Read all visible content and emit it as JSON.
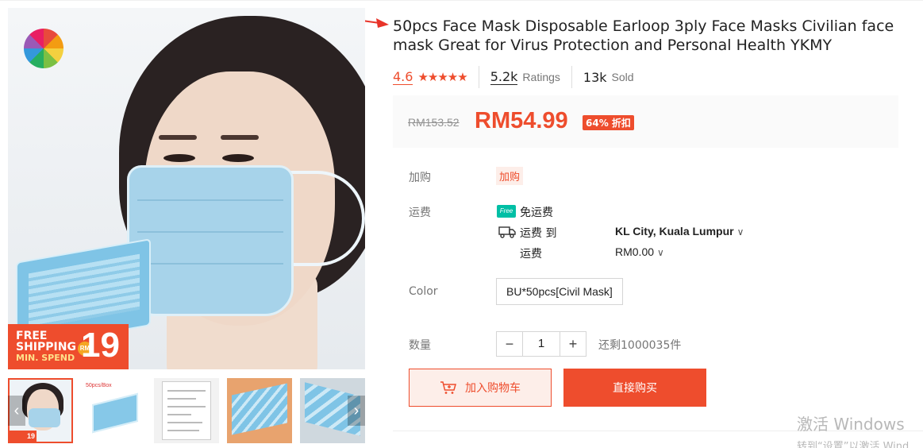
{
  "product": {
    "title": "50pcs Face Mask Disposable Earloop 3ply Face Masks Civilian face mask Great for Virus Protection and Personal Health YKMY"
  },
  "main_image": {
    "promo": {
      "line1": "FREE",
      "line2": "SHIPPING",
      "line3": "MIN. SPEND",
      "currency": "RM",
      "amount": "19"
    }
  },
  "thumbnails": {
    "items": [
      {
        "name": "thumb-model",
        "promo": "19"
      },
      {
        "name": "thumb-box",
        "caption": "50pcs/Box"
      },
      {
        "name": "thumb-certificate"
      },
      {
        "name": "thumb-masks-stack"
      },
      {
        "name": "thumb-masks-pile"
      }
    ],
    "prev_icon": "chevron-left-icon",
    "next_icon": "chevron-right-icon"
  },
  "rating": {
    "value": "4.6",
    "stars_glyph": "★★★★★",
    "ratings_count": "5.2k",
    "ratings_label": "Ratings",
    "sold_count": "13k",
    "sold_label": "Sold"
  },
  "price": {
    "original": "RM153.52",
    "current": "RM54.99",
    "discount": "64% 折扣"
  },
  "addon": {
    "label": "加购",
    "tag": "加购"
  },
  "shipping": {
    "label": "运费",
    "free_badge": "Free",
    "free_text": "免运费",
    "to_label": "运费 到",
    "location": "KL City, Kuala Lumpur",
    "fee_label": "运费",
    "fee_value": "RM0.00",
    "chevron": "∨"
  },
  "variation": {
    "label": "Color",
    "option": "BU*50pcs[Civil Mask]"
  },
  "quantity": {
    "label": "数量",
    "minus": "−",
    "value": "1",
    "plus": "+",
    "stock": "还剩1000035件"
  },
  "actions": {
    "add_to_cart": "加入购物车",
    "buy_now": "直接购买"
  },
  "watermark": {
    "title": "激活 Windows",
    "subtitle": "转到“设置”以激活 Wind"
  },
  "colors": {
    "accent": "#ee4d2d",
    "free_ship": "#00bfa5"
  }
}
